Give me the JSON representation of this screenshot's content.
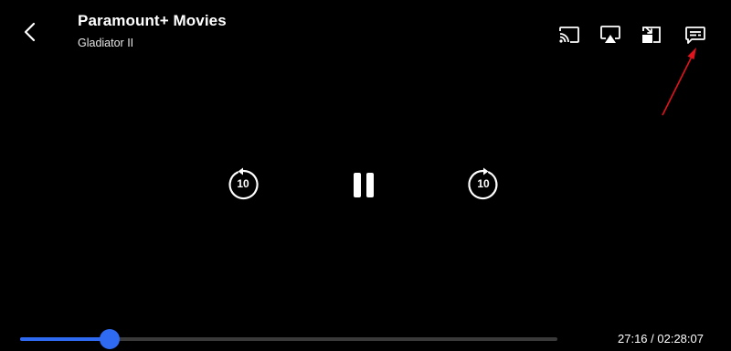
{
  "header": {
    "title": "Paramount+ Movies",
    "subtitle": "Gladiator II"
  },
  "top_controls": {
    "icons": [
      "chevron-left-icon",
      "cast-icon",
      "airplay-icon",
      "picture-in-picture-icon",
      "subtitles-icon"
    ]
  },
  "playback": {
    "rewind_seconds": "10",
    "forward_seconds": "10",
    "state": "playing"
  },
  "progress": {
    "fraction": 0.167,
    "time_text": "27:16 / 02:28:07"
  },
  "colors": {
    "accent": "#2f6af2",
    "annotation": "#e0141c",
    "track": "#3a3a3a",
    "background": "#000000"
  }
}
